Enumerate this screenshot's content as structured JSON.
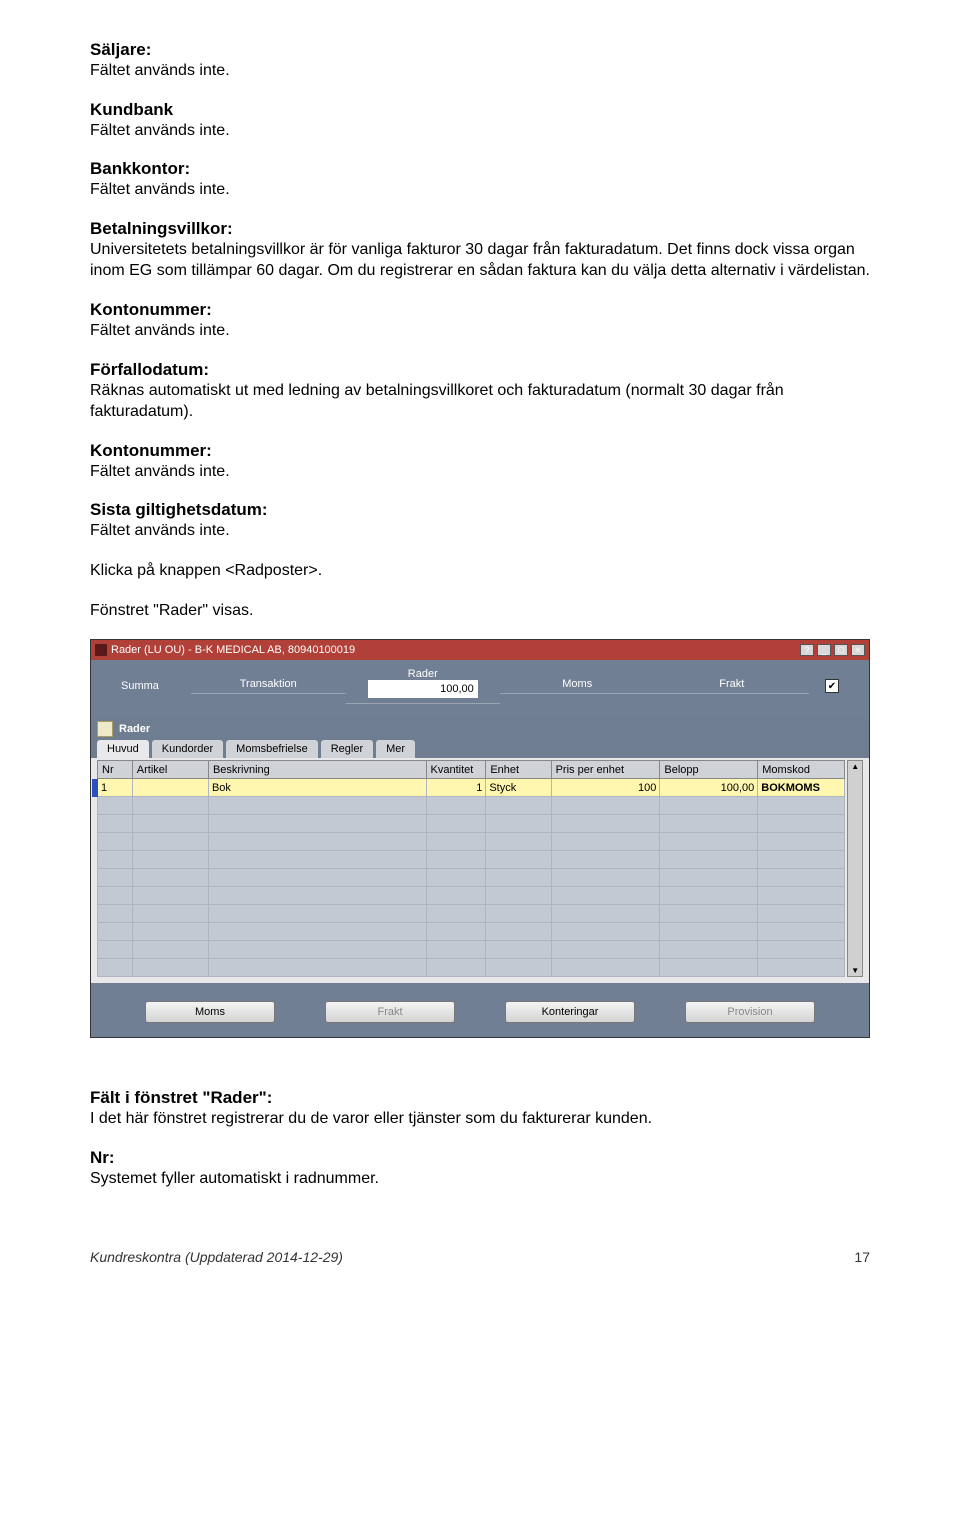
{
  "sections": [
    {
      "heading": "Säljare:",
      "body": "Fältet används inte."
    },
    {
      "heading": "Kundbank",
      "body": "Fältet används inte."
    },
    {
      "heading": "Bankkontor:",
      "body": "Fältet används inte."
    },
    {
      "heading": "Betalningsvillkor:",
      "body": "Universitetets betalningsvillkor är för vanliga fakturor 30 dagar från fakturadatum. Det finns dock vissa organ inom EG som tillämpar 60 dagar. Om du registrerar en sådan faktura kan du välja detta alternativ i värdelistan."
    },
    {
      "heading": "Kontonummer:",
      "body": "Fältet används inte."
    },
    {
      "heading": "Förfallodatum:",
      "body": "Räknas automatiskt ut med ledning av betalningsvillkoret och fakturadatum (normalt 30 dagar från fakturadatum)."
    },
    {
      "heading": "Kontonummer:",
      "body": "Fältet används inte."
    },
    {
      "heading": "Sista giltighetsdatum:",
      "body": "Fältet används inte."
    }
  ],
  "click_text": "Klicka på knappen <Radposter>.",
  "window_text": "Fönstret \"Rader\" visas.",
  "screenshot": {
    "title": "Rader (LU OU) - B-K MEDICAL AB, 80940100019",
    "summary": {
      "label": "Summa",
      "cols": [
        "Transaktion",
        "Rader",
        "Moms",
        "Frakt"
      ],
      "value": "100,00",
      "checked": "✔"
    },
    "panel_label": "Rader",
    "tabs": [
      "Huvud",
      "Kundorder",
      "Momsbefrielse",
      "Regler",
      "Mer"
    ],
    "columns": [
      "Nr",
      "Artikel",
      "Beskrivning",
      "Kvantitet",
      "Enhet",
      "Pris per enhet",
      "Belopp",
      "Momskod"
    ],
    "row": {
      "nr": "1",
      "artikel": "",
      "beskrivning": "Bok",
      "kvantitet": "1",
      "enhet": "Styck",
      "pris": "100",
      "belopp": "100,00",
      "momskod": "BOKMOMS"
    },
    "buttons": [
      "Moms",
      "Frakt",
      "Konteringar",
      "Provision"
    ]
  },
  "after": {
    "heading1": "Fält i fönstret \"Rader\":",
    "text1": "I det här fönstret registrerar du de varor eller tjänster som du fakturerar kunden.",
    "heading2": "Nr:",
    "text2": "Systemet fyller automatiskt i radnummer."
  },
  "footer": {
    "left": "Kundreskontra (Uppdaterad 2014-12-29)",
    "right": "17"
  }
}
